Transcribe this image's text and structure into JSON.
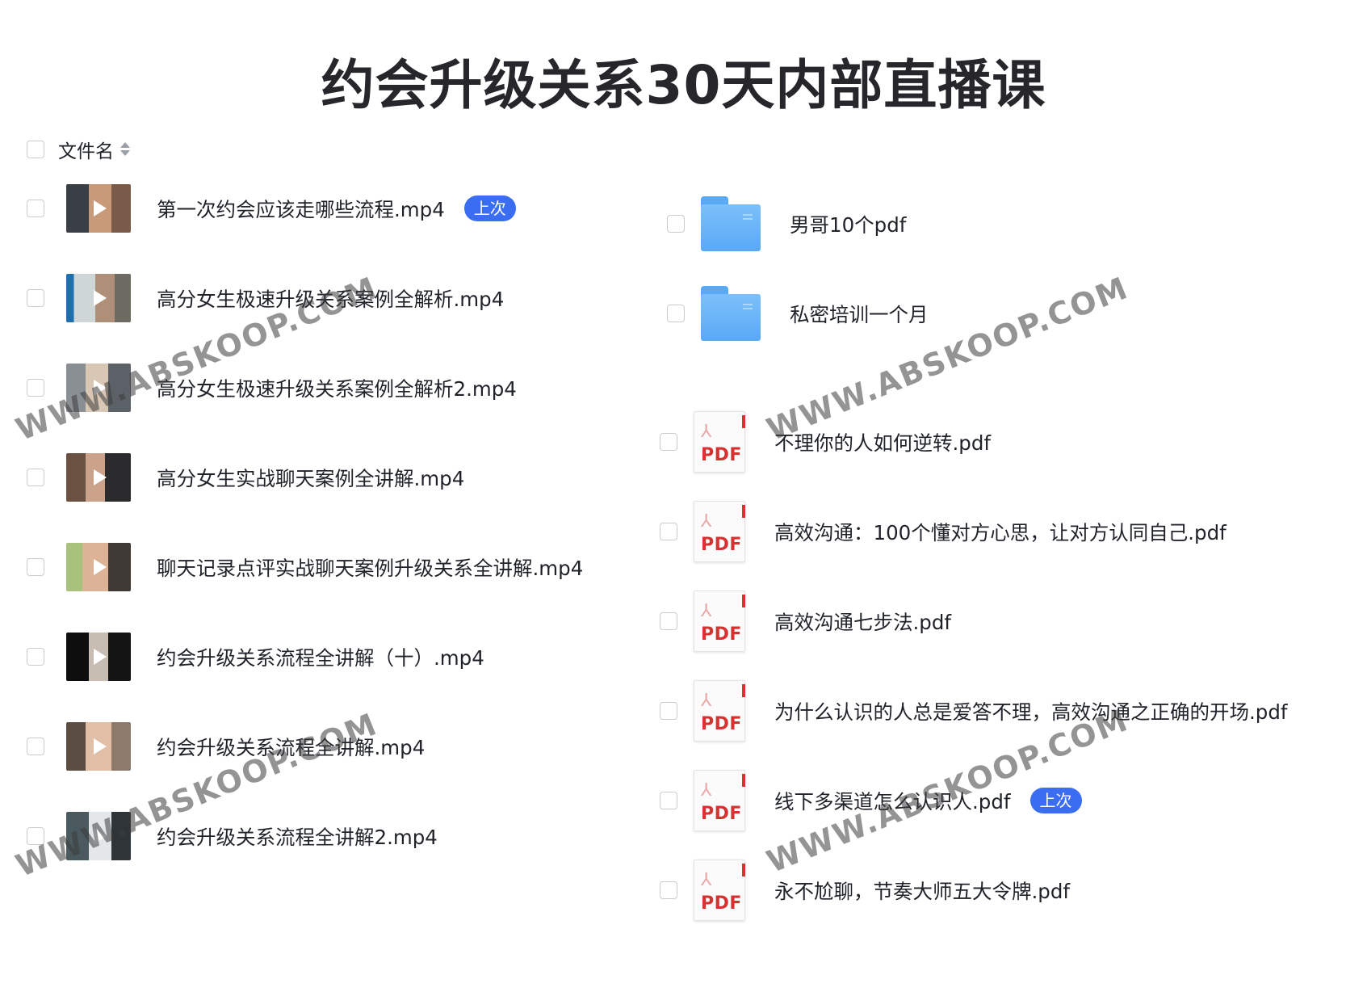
{
  "title": "约会升级关系30天内部直播课",
  "header": {
    "column_label": "文件名"
  },
  "badge_label": "上次",
  "pdf_icon_text": "PDF",
  "left_files": [
    {
      "name": "第一次约会应该走哪些流程.mp4",
      "last": true
    },
    {
      "name": "高分女生极速升级关系案例全解析.mp4",
      "last": false
    },
    {
      "name": "高分女生极速升级关系案例全解析2.mp4",
      "last": false
    },
    {
      "name": "高分女生实战聊天案例全讲解.mp4",
      "last": false
    },
    {
      "name": "聊天记录点评实战聊天案例升级关系全讲解.mp4",
      "last": false
    },
    {
      "name": "约会升级关系流程全讲解（十）.mp4",
      "last": false
    },
    {
      "name": "约会升级关系流程全讲解.mp4",
      "last": false
    },
    {
      "name": "约会升级关系流程全讲解2.mp4",
      "last": false
    }
  ],
  "right_folders": [
    {
      "name": "男哥10个pdf"
    },
    {
      "name": "私密培训一个月"
    }
  ],
  "right_pdfs": [
    {
      "name": "不理你的人如何逆转.pdf",
      "last": false
    },
    {
      "name": "高效沟通：100个懂对方心思，让对方认同自己.pdf",
      "last": false
    },
    {
      "name": "高效沟通七步法.pdf",
      "last": false
    },
    {
      "name": "为什么认识的人总是爱答不理，高效沟通之正确的开场.pdf",
      "last": false
    },
    {
      "name": "线下多渠道怎么认识人.pdf",
      "last": true
    },
    {
      "name": "永不尬聊，节奏大师五大令牌.pdf",
      "last": false
    }
  ],
  "watermark": "WWW.ABSKOOP.COM",
  "colors": {
    "badge": "#3b6df2",
    "folder": "#5aa9f5",
    "pdf_red": "#d73131"
  }
}
